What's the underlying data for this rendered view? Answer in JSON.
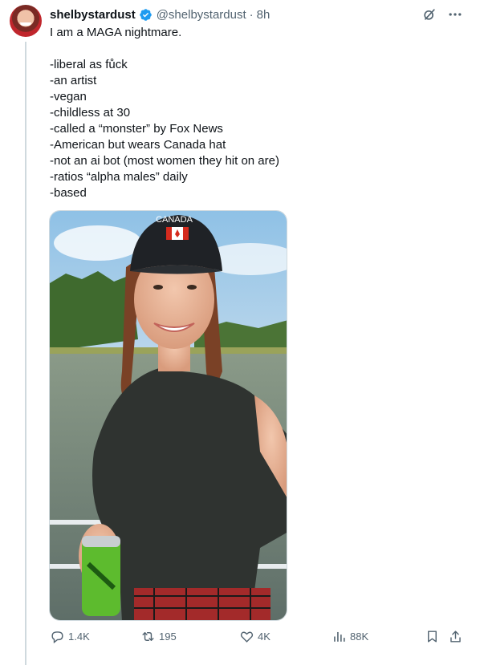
{
  "author": {
    "name": "shelbystardust",
    "handle": "@shelbystardust",
    "separator": "·",
    "time": "8h"
  },
  "tweet": {
    "text": "I am a MAGA nightmare.\n\n-liberal as fůck\n-an artist\n-vegan\n-childless at 30\n-called a “monster” by Fox News\n-American but wears Canada hat\n-not an ai bot (most women they hit on are)\n-ratios “alpha males” daily\n-based",
    "image_hat_text": "CANADA"
  },
  "actions": {
    "replies": "1.4K",
    "reposts": "195",
    "likes": "4K",
    "views": "88K"
  },
  "icons": {
    "verified": "verified-badge-icon",
    "grok": "grok-icon",
    "more": "more-icon",
    "reply": "reply-icon",
    "repost": "repost-icon",
    "like": "heart-icon",
    "views": "views-icon",
    "bookmark": "bookmark-icon",
    "share": "share-icon"
  },
  "colors": {
    "text": "#0f1419",
    "secondary": "#536471",
    "verified": "#1d9bf0",
    "divider": "#cfd9de"
  }
}
